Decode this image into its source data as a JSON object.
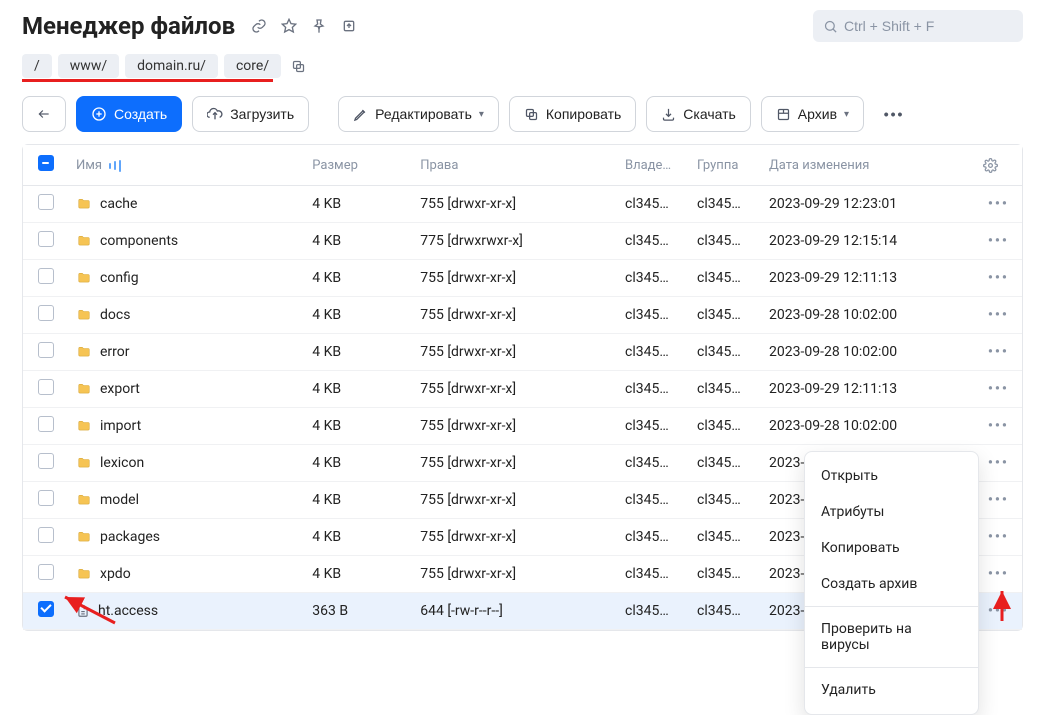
{
  "header": {
    "title": "Менеджер файлов",
    "search_placeholder": "Ctrl + Shift + F"
  },
  "breadcrumbs": [
    "/",
    "www/",
    "domain.ru/",
    "core/"
  ],
  "toolbar": {
    "create": "Создать",
    "upload": "Загрузить",
    "edit": "Редактировать",
    "copy": "Копировать",
    "download": "Скачать",
    "archive": "Архив"
  },
  "columns": {
    "name": "Имя",
    "size": "Размер",
    "perms": "Права",
    "owner": "Владе…",
    "group": "Группа",
    "date": "Дата изменения"
  },
  "rows": [
    {
      "type": "dir",
      "name": "cache",
      "size": "4 KB",
      "perms": "755 [drwxr-xr-x]",
      "owner": "cl345…",
      "group": "cl345…",
      "date": "2023-09-29 12:23:01",
      "checked": false
    },
    {
      "type": "dir",
      "name": "components",
      "size": "4 KB",
      "perms": "775 [drwxrwxr-x]",
      "owner": "cl345…",
      "group": "cl345…",
      "date": "2023-09-29 12:15:14",
      "checked": false
    },
    {
      "type": "dir",
      "name": "config",
      "size": "4 KB",
      "perms": "755 [drwxr-xr-x]",
      "owner": "cl345…",
      "group": "cl345…",
      "date": "2023-09-29 12:11:13",
      "checked": false
    },
    {
      "type": "dir",
      "name": "docs",
      "size": "4 KB",
      "perms": "755 [drwxr-xr-x]",
      "owner": "cl345…",
      "group": "cl345…",
      "date": "2023-09-28 10:02:00",
      "checked": false
    },
    {
      "type": "dir",
      "name": "error",
      "size": "4 KB",
      "perms": "755 [drwxr-xr-x]",
      "owner": "cl345…",
      "group": "cl345…",
      "date": "2023-09-28 10:02:00",
      "checked": false
    },
    {
      "type": "dir",
      "name": "export",
      "size": "4 KB",
      "perms": "755 [drwxr-xr-x]",
      "owner": "cl345…",
      "group": "cl345…",
      "date": "2023-09-29 12:11:13",
      "checked": false
    },
    {
      "type": "dir",
      "name": "import",
      "size": "4 KB",
      "perms": "755 [drwxr-xr-x]",
      "owner": "cl345…",
      "group": "cl345…",
      "date": "2023-09-28 10:02:00",
      "checked": false
    },
    {
      "type": "dir",
      "name": "lexicon",
      "size": "4 KB",
      "perms": "755 [drwxr-xr-x]",
      "owner": "cl345…",
      "group": "cl345…",
      "date": "2023-09-28 10:02:00",
      "checked": false
    },
    {
      "type": "dir",
      "name": "model",
      "size": "4 KB",
      "perms": "755 [drwxr-xr-x]",
      "owner": "cl345…",
      "group": "cl345…",
      "date": "2023-09-28 10:02:00",
      "checked": false
    },
    {
      "type": "dir",
      "name": "packages",
      "size": "4 KB",
      "perms": "755 [drwxr-xr-x]",
      "owner": "cl345…",
      "group": "cl345…",
      "date": "2023-09-29 12:11:13",
      "checked": false
    },
    {
      "type": "dir",
      "name": "xpdo",
      "size": "4 KB",
      "perms": "755 [drwxr-xr-x]",
      "owner": "cl345…",
      "group": "cl345…",
      "date": "2023-09-28 10:02:00",
      "checked": false
    },
    {
      "type": "file",
      "name": "ht.access",
      "size": "363 B",
      "perms": "644 [-rw-r--r--]",
      "owner": "cl345…",
      "group": "cl345…",
      "date": "2023-09-28 10:01:46",
      "checked": true
    }
  ],
  "context_menu": {
    "open": "Открыть",
    "attributes": "Атрибуты",
    "copy": "Копировать",
    "archive": "Создать архив",
    "scan": "Проверить на вирусы",
    "delete": "Удалить"
  }
}
